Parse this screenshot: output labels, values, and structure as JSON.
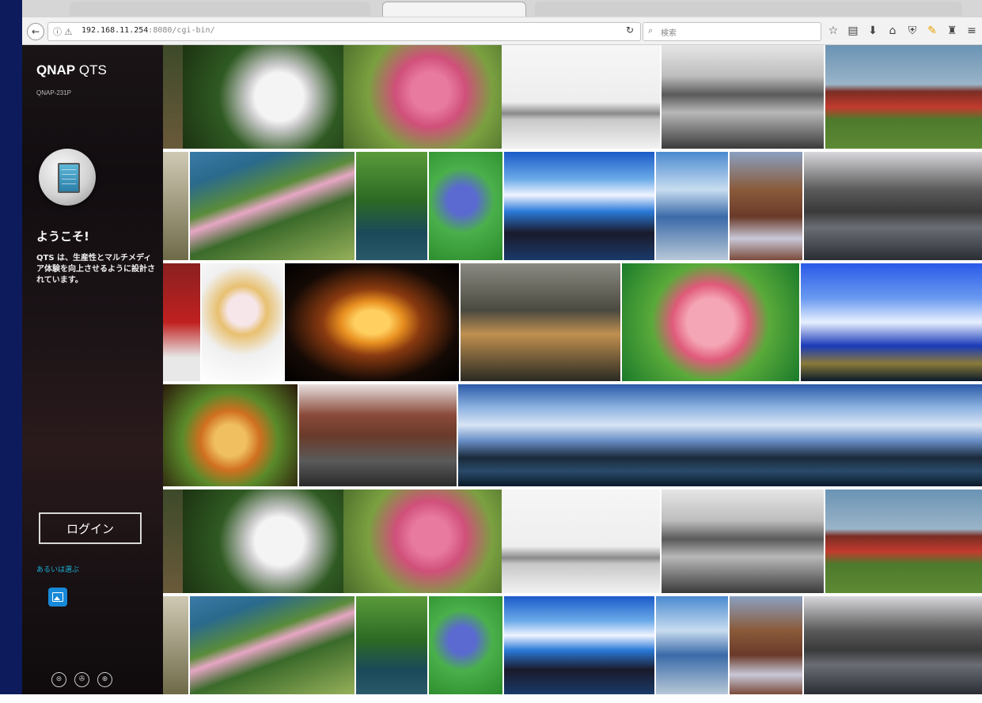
{
  "browser": {
    "url_host": "192.168.11.254",
    "url_path": ":8080/cgi-bin/",
    "search_placeholder": "検索",
    "back_icon": "back-arrow-icon",
    "toolbar_icons": [
      "star-icon",
      "clipboard-icon",
      "download-icon",
      "home-icon",
      "shield-icon",
      "extension-icon",
      "extension-icon",
      "menu-icon"
    ]
  },
  "sidebar": {
    "brand_bold": "QNAP",
    "brand_rest": " QTS",
    "model": "QNAP-231P",
    "welcome": "ようこそ!",
    "description": "QTS は、生産性とマルチメディア体験を向上させるように設計されています。",
    "login_button": "ログイン",
    "or_text": "あるいは選ぶ",
    "app_icon": "photo-station-icon",
    "footer_icons": [
      "network-icon",
      "tools-icon",
      "language-icon"
    ]
  },
  "colors": {
    "frame": "#0d1a5c",
    "sidebar_bg": "#120d10",
    "or_text": "#1cb0d8",
    "app_icon": "#1789d8"
  }
}
